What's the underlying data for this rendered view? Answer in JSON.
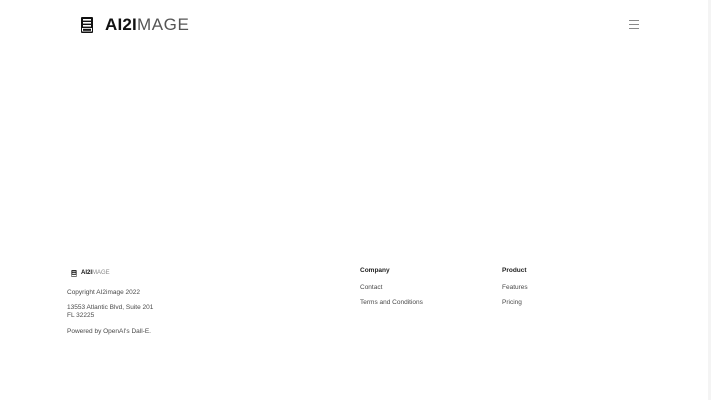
{
  "header": {
    "brand_bold": "AI2I",
    "brand_light": "MAGE",
    "brand_icon": "ai-image-document-icon",
    "menu_icon": "hamburger-menu-icon"
  },
  "footer": {
    "brand_bold": "AI2I",
    "brand_light": "MAGE",
    "copyright": "Copyright AI2image 2022",
    "address_line1": "13553 Atlantic Blvd, Suite 201",
    "address_line2": "FL 32225",
    "powered_by": "Powered by OpenAI's Dall-E.",
    "company": {
      "title": "Company",
      "links": [
        "Contact",
        "Terms and Conditions"
      ]
    },
    "product": {
      "title": "Product",
      "links": [
        "Features",
        "Pricing"
      ]
    }
  },
  "colors": {
    "text": "#3a3a3a",
    "heading": "#222222",
    "brand_dark": "#111111",
    "icon_gray": "#8a8a8a",
    "background": "#ffffff"
  }
}
